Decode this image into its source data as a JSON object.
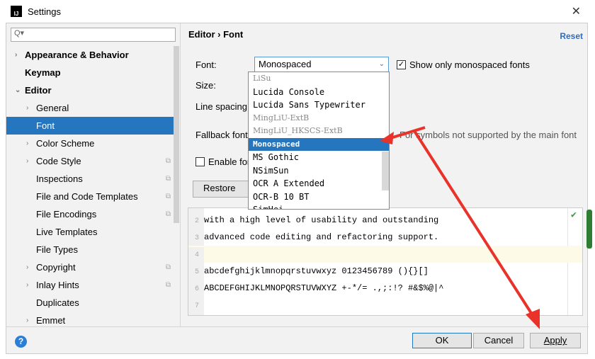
{
  "window": {
    "title": "Settings",
    "close": "✕"
  },
  "sidebar": {
    "search_placeholder": "Q▾",
    "items": [
      {
        "label": "Appearance & Behavior",
        "level": 0,
        "arrow": "›",
        "bold": true
      },
      {
        "label": "Keymap",
        "level": 0,
        "arrow": "",
        "bold": true
      },
      {
        "label": "Editor",
        "level": 0,
        "arrow": "⌄",
        "bold": true
      },
      {
        "label": "General",
        "level": 1,
        "arrow": "›"
      },
      {
        "label": "Font",
        "level": 1,
        "arrow": "",
        "selected": true
      },
      {
        "label": "Color Scheme",
        "level": 1,
        "arrow": "›"
      },
      {
        "label": "Code Style",
        "level": 1,
        "arrow": "›",
        "copy": true
      },
      {
        "label": "Inspections",
        "level": 1,
        "arrow": "",
        "copy": true
      },
      {
        "label": "File and Code Templates",
        "level": 1,
        "arrow": "",
        "copy": true
      },
      {
        "label": "File Encodings",
        "level": 1,
        "arrow": "",
        "copy": true
      },
      {
        "label": "Live Templates",
        "level": 1,
        "arrow": ""
      },
      {
        "label": "File Types",
        "level": 1,
        "arrow": ""
      },
      {
        "label": "Copyright",
        "level": 1,
        "arrow": "›",
        "copy": true
      },
      {
        "label": "Inlay Hints",
        "level": 1,
        "arrow": "›",
        "copy": true
      },
      {
        "label": "Duplicates",
        "level": 1,
        "arrow": ""
      },
      {
        "label": "Emmet",
        "level": 1,
        "arrow": "›"
      }
    ]
  },
  "main": {
    "breadcrumb": "Editor  ›  Font",
    "reset": "Reset",
    "font_label": "Font:",
    "font_value": "Monospaced",
    "show_mono": "Show only monospaced fonts",
    "size_label": "Size:",
    "line_spacing_label": "Line spacing:",
    "fallback_label": "Fallback font:",
    "fallback_note": "For symbols not supported by the main font",
    "ligatures": "Enable font",
    "restore": "Restore Defa",
    "dropdown": [
      {
        "label": "LiSu",
        "style": "g"
      },
      {
        "label": "Lucida Console"
      },
      {
        "label": "Lucida Sans Typewriter"
      },
      {
        "label": "MingLiU-ExtB",
        "style": "g"
      },
      {
        "label": "MingLiU_HKSCS-ExtB",
        "style": "g"
      },
      {
        "label": "Monospaced",
        "style": "sel"
      },
      {
        "label": "MS Gothic"
      },
      {
        "label": "NSimSun"
      },
      {
        "label": "OCR A Extended"
      },
      {
        "label": "OCR-B 10 BT"
      },
      {
        "label": "SimHei"
      }
    ]
  },
  "editor": {
    "lines": [
      {
        "n": "2",
        "text": "with a high level of usability and outstanding"
      },
      {
        "n": "3",
        "text": "advanced code editing and refactoring support."
      },
      {
        "n": "4",
        "text": "",
        "current": true
      },
      {
        "n": "5",
        "text": "abcdefghijklmnopqrstuvwxyz 0123456789 (){}[]"
      },
      {
        "n": "6",
        "text": "ABCDEFGHIJKLMNOPQRSTUVWXYZ +-*/= .,;:!? #&$%@|^"
      },
      {
        "n": "7",
        "text": ""
      }
    ]
  },
  "buttons": {
    "ok": "OK",
    "cancel": "Cancel",
    "apply": "Apply",
    "help": "?"
  },
  "colors": {
    "accent": "#2675bf",
    "annotation": "#e8322a"
  }
}
